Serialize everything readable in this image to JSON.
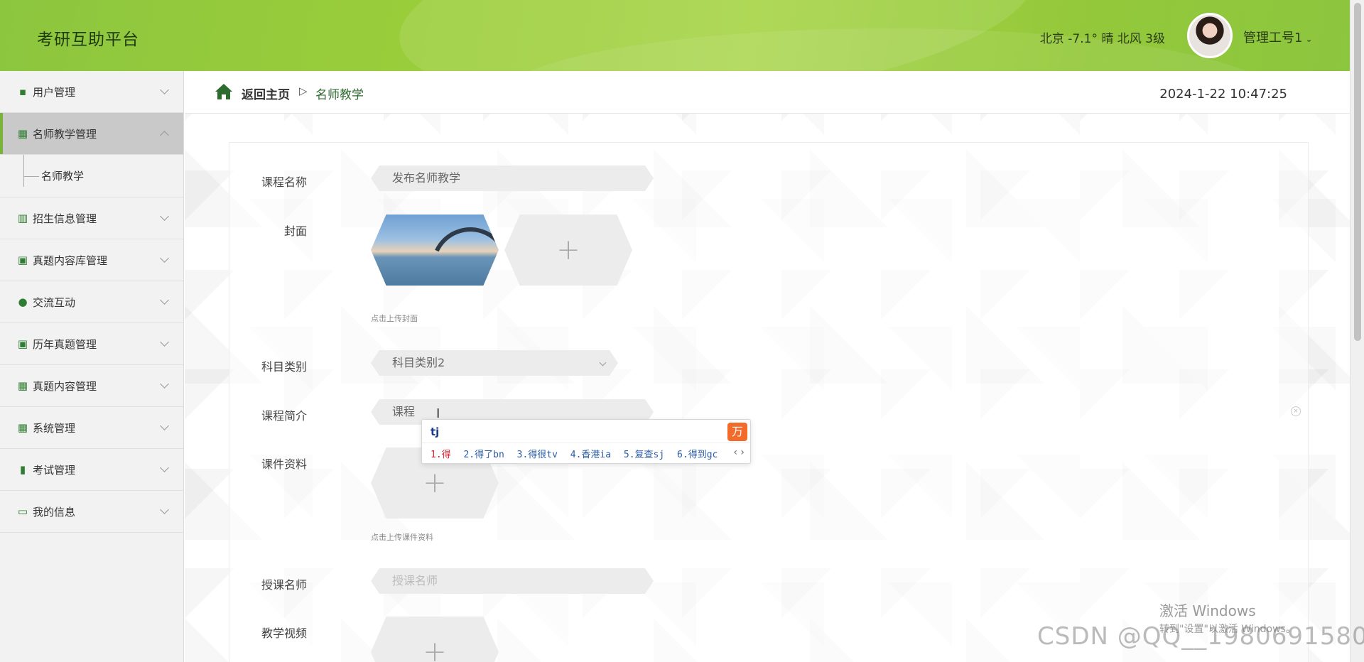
{
  "header": {
    "app_title": "考研互助平台",
    "weather": "北京 -7.1° 晴 北风 3级",
    "user_name": "管理工号1",
    "user_chevron": "⌄"
  },
  "sidebar": {
    "items": [
      {
        "label": "用户管理",
        "icon": "chat-icon"
      },
      {
        "label": "名师教学管理",
        "icon": "grid-icon",
        "active": true
      },
      {
        "label": "名师教学",
        "sub": true
      },
      {
        "label": "招生信息管理",
        "icon": "books-icon"
      },
      {
        "label": "真题内容库管理",
        "icon": "clipboard-x-icon"
      },
      {
        "label": "交流互动",
        "icon": "user-icon"
      },
      {
        "label": "历年真题管理",
        "icon": "clipboard-check-icon"
      },
      {
        "label": "真题内容管理",
        "icon": "grid-icon"
      },
      {
        "label": "系统管理",
        "icon": "grid-icon"
      },
      {
        "label": "考试管理",
        "icon": "bar-chart-icon"
      },
      {
        "label": "我的信息",
        "icon": "card-icon"
      }
    ]
  },
  "breadcrumb": {
    "home": "返回主页",
    "separator": "▷",
    "current": "名师教学"
  },
  "datetime": "2024-1-22 10:47:25",
  "form": {
    "course_name_label": "课程名称",
    "course_name_value": "发布名师教学",
    "cover_label": "封面",
    "cover_hint": "点击上传封面",
    "subject_label": "科目类别",
    "subject_value": "科目类别2",
    "intro_label": "课程简介",
    "intro_value": "课程",
    "material_label": "课件资料",
    "material_hint": "点击上传课件资料",
    "teacher_label": "授课名师",
    "teacher_placeholder": "授课名师",
    "video_label": "教学视频",
    "plus": "+"
  },
  "ime": {
    "composition": "tj",
    "logo": "万",
    "candidates": [
      "1.得",
      "2.得了bn",
      "3.得很tv",
      "4.香港ia",
      "5.复查sj",
      "6.得到gc"
    ],
    "nav": "‹ ›"
  },
  "overlay": {
    "win_activate_title": "激活 Windows",
    "win_activate_sub": "转到\"设置\"以激活 Windows。",
    "watermark": "CSDN @QQ__1980691580"
  },
  "colors": {
    "header_green": "#9acd3a",
    "accent": "#7ab33a",
    "icon_green": "#2e7d32"
  }
}
